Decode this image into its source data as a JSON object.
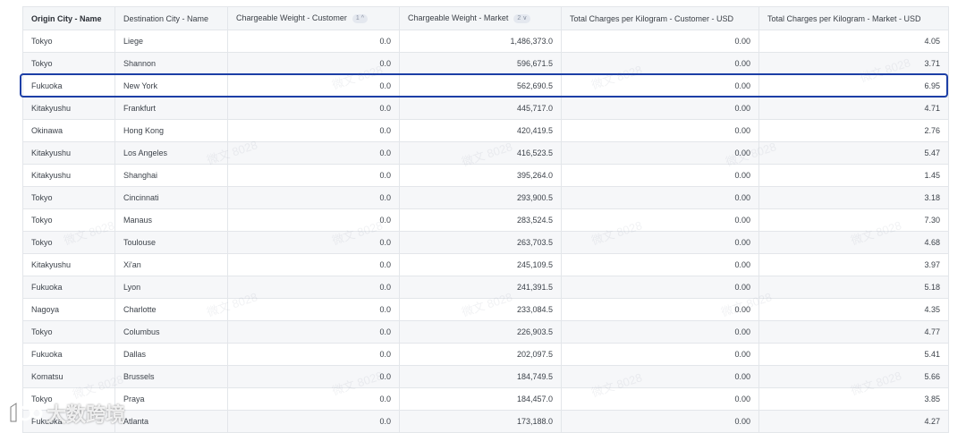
{
  "columns": [
    {
      "label": "Origin City - Name",
      "sort": ""
    },
    {
      "label": "Destination City - Name",
      "sort": ""
    },
    {
      "label": "Chargeable Weight - Customer",
      "sort": "1 ^"
    },
    {
      "label": "Chargeable Weight - Market",
      "sort": "2 ∨"
    },
    {
      "label": "Total Charges per Kilogram - Customer - USD",
      "sort": ""
    },
    {
      "label": "Total Charges per Kilogram - Market - USD",
      "sort": ""
    }
  ],
  "rows": [
    [
      "Tokyo",
      "Liege",
      "0.0",
      "1,486,373.0",
      "0.00",
      "4.05"
    ],
    [
      "Tokyo",
      "Shannon",
      "0.0",
      "596,671.5",
      "0.00",
      "3.71"
    ],
    [
      "Fukuoka",
      "New York",
      "0.0",
      "562,690.5",
      "0.00",
      "6.95"
    ],
    [
      "Kitakyushu",
      "Frankfurt",
      "0.0",
      "445,717.0",
      "0.00",
      "4.71"
    ],
    [
      "Okinawa",
      "Hong Kong",
      "0.0",
      "420,419.5",
      "0.00",
      "2.76"
    ],
    [
      "Kitakyushu",
      "Los Angeles",
      "0.0",
      "416,523.5",
      "0.00",
      "5.47"
    ],
    [
      "Kitakyushu",
      "Shanghai",
      "0.0",
      "395,264.0",
      "0.00",
      "1.45"
    ],
    [
      "Tokyo",
      "Cincinnati",
      "0.0",
      "293,900.5",
      "0.00",
      "3.18"
    ],
    [
      "Tokyo",
      "Manaus",
      "0.0",
      "283,524.5",
      "0.00",
      "7.30"
    ],
    [
      "Tokyo",
      "Toulouse",
      "0.0",
      "263,703.5",
      "0.00",
      "4.68"
    ],
    [
      "Kitakyushu",
      "Xi'an",
      "0.0",
      "245,109.5",
      "0.00",
      "3.97"
    ],
    [
      "Fukuoka",
      "Lyon",
      "0.0",
      "241,391.5",
      "0.00",
      "5.18"
    ],
    [
      "Nagoya",
      "Charlotte",
      "0.0",
      "233,084.5",
      "0.00",
      "4.35"
    ],
    [
      "Tokyo",
      "Columbus",
      "0.0",
      "226,903.5",
      "0.00",
      "4.77"
    ],
    [
      "Fukuoka",
      "Dallas",
      "0.0",
      "202,097.5",
      "0.00",
      "5.41"
    ],
    [
      "Komatsu",
      "Brussels",
      "0.0",
      "184,749.5",
      "0.00",
      "5.66"
    ],
    [
      "Tokyo",
      "Praya",
      "0.0",
      "184,457.0",
      "0.00",
      "3.85"
    ],
    [
      "Fukuoka",
      "Atlanta",
      "0.0",
      "173,188.0",
      "0.00",
      "4.27"
    ]
  ],
  "watermark_text": "微文 8028",
  "logo_text": "大数跨境",
  "highlight_color": "#1d3fa6"
}
